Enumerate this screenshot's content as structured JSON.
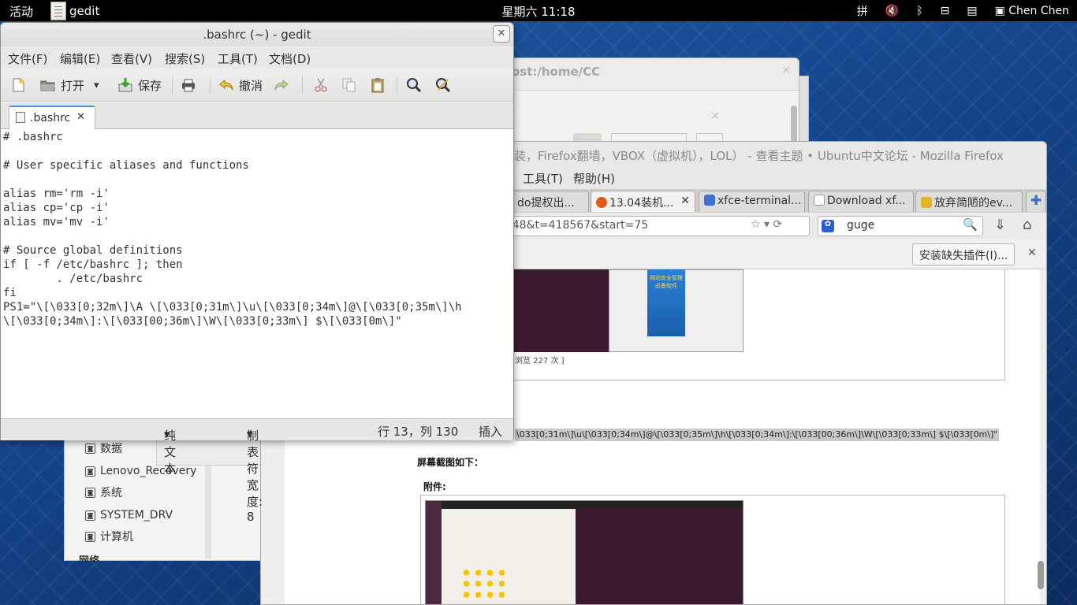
{
  "topbar": {
    "activities": "活动",
    "app_name": "gedit",
    "clock": "星期六 11:18",
    "input_method": "拼",
    "user": "Chen Chen"
  },
  "terminal": {
    "title": "ost:/home/CC"
  },
  "filemanager": {
    "items": [
      "数据",
      "Lenovo_Recovery",
      "系统",
      "SYSTEM_DRV",
      "计算机"
    ],
    "section": "网络"
  },
  "firefox": {
    "title": "安装，Firefox翻墙，VBOX（虚拟机），LOL） - 查看主题 • Ubuntu中文论坛 - Mozilla Firefox",
    "menu": [
      "工具(T)",
      "帮助(H)"
    ],
    "tabs": [
      {
        "label": "do提权出..."
      },
      {
        "label": "13.04装机..."
      },
      {
        "label": "xfce-terminal..."
      },
      {
        "label": "Download xf..."
      },
      {
        "label": "放弃简陋的ev..."
      }
    ],
    "url_tail": "=48&t=418567&start=75",
    "search_value": "guge",
    "plugin_button": "安装缺失插件(I)...",
    "view_count": "浏览 227 次 ]",
    "ps1_snippet": "\\033[0;31m\\]\\u\\[\\033[0;34m\\]@\\[\\033[0;35m\\]\\h\\[\\033[0;34m\\]:\\[\\033[00;36m\\]\\W\\[\\033[0;33m\\] $\\[\\033[0m\\]\"",
    "screenshot_caption": "屏幕截图如下：",
    "attachment_label": "附件:",
    "banner_text": "网站安全管理 必备软件"
  },
  "gedit": {
    "title": ".bashrc (~) - gedit",
    "menu": [
      "文件(F)",
      "编辑(E)",
      "查看(V)",
      "搜索(S)",
      "工具(T)",
      "文档(D)"
    ],
    "toolbar": {
      "open": "打开",
      "save": "保存",
      "undo": "撤消"
    },
    "tab_label": ".bashrc",
    "lines": [
      "# .bashrc",
      "",
      "# User specific aliases and functions",
      "",
      "alias rm='rm -i'",
      "alias cp='cp -i'",
      "alias mv='mv -i'",
      "",
      "# Source global definitions",
      "if [ -f /etc/bashrc ]; then",
      "        . /etc/bashrc",
      "fi",
      "PS1=\"\\[\\033[0;32m\\]\\A \\[\\033[0;31m\\]\\u\\[\\033[0;34m\\]@\\[\\033[0;35m\\]\\h",
      "\\[\\033[0;34m\\]:\\[\\033[00;36m\\]\\W\\[\\033[0;33m\\] $\\[\\033[0m\\]\""
    ],
    "status": {
      "syntax": "纯文本",
      "tab_width": "制表符宽度: 8",
      "position": "行 13，列 130",
      "mode": "插入"
    }
  }
}
